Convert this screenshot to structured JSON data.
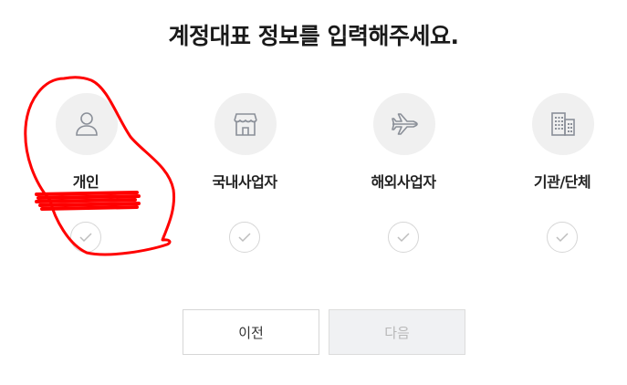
{
  "page": {
    "title": "계정대표 정보를 입력해주세요."
  },
  "options": [
    {
      "label": "개인",
      "icon": "person-icon",
      "selected": false
    },
    {
      "label": "국내사업자",
      "icon": "store-icon",
      "selected": false
    },
    {
      "label": "해외사업자",
      "icon": "airplane-icon",
      "selected": false
    },
    {
      "label": "기관/단체",
      "icon": "building-icon",
      "selected": false
    }
  ],
  "buttons": {
    "prev_label": "이전",
    "next_label": "다음",
    "next_enabled": false
  },
  "colors": {
    "annotation_red": "#ff0000",
    "icon_gray": "#8a8f98",
    "circle_bg": "#f0f0f0"
  }
}
